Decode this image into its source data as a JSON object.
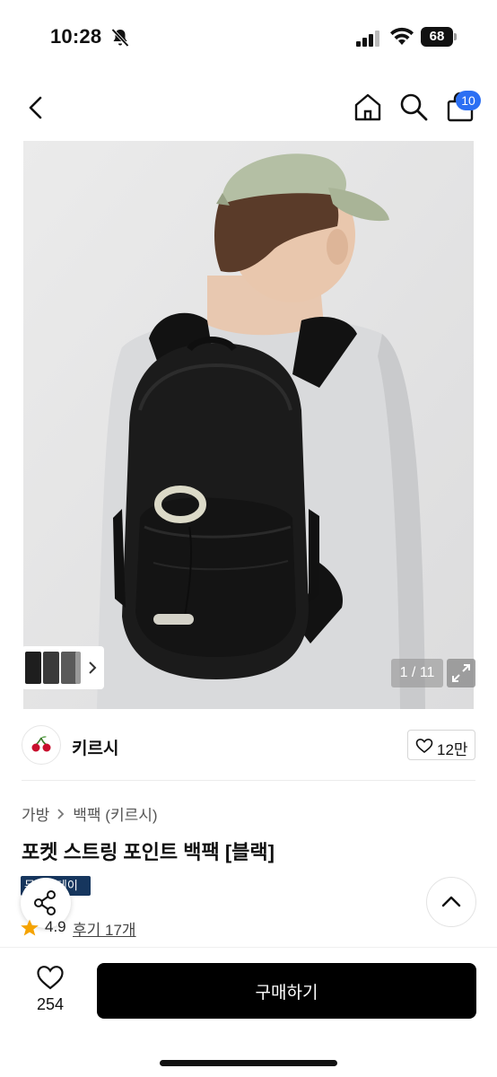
{
  "status_bar": {
    "time": "10:28",
    "battery": "68"
  },
  "nav": {
    "cart_count": "10",
    "icons": [
      "back-icon",
      "home-icon",
      "search-icon",
      "cart-icon"
    ]
  },
  "gallery": {
    "counter": "1 / 11",
    "background_color": "#e4e4e5"
  },
  "brand": {
    "name": "키르시",
    "like_count": "12만"
  },
  "product": {
    "breadcrumbs": [
      "가방",
      "백팩 (키르시)"
    ],
    "title": "포켓 스트링 포인트 백팩 [블랙]",
    "tag": "무신사데이",
    "rating": "4.9",
    "reviews": "후기 17개"
  },
  "bottom_bar": {
    "wish_count": "254",
    "buy_label": "구매하기"
  },
  "colors": {
    "accent_badge": "#2b6ff3",
    "tag": "#16365e",
    "buy_button": "#000000",
    "star": "#f5a300"
  }
}
